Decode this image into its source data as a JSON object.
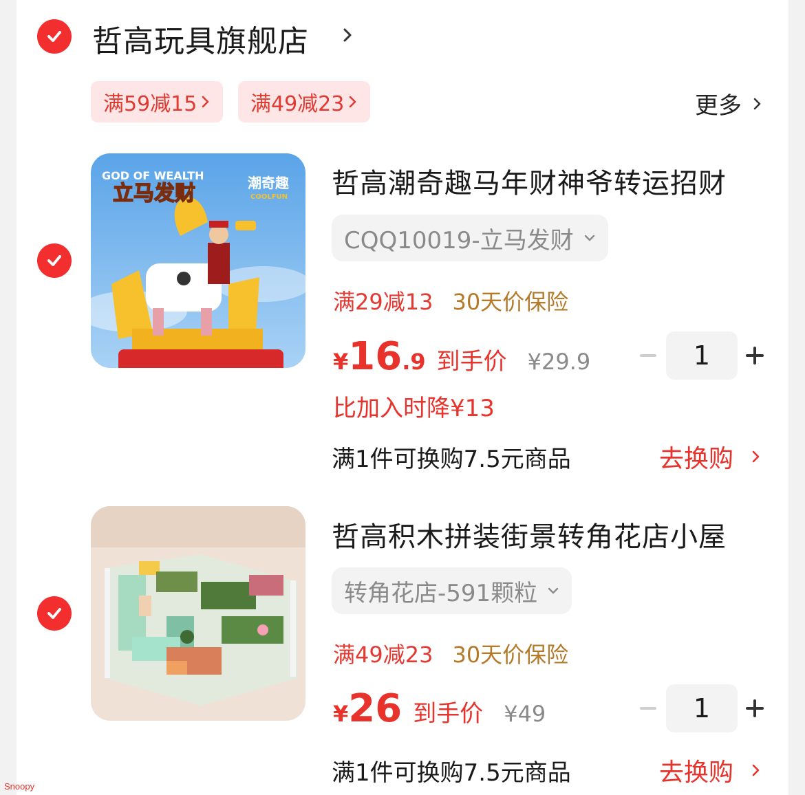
{
  "store": {
    "name": "哲高玩具旗舰店"
  },
  "coupons": [
    {
      "label": "满59减15"
    },
    {
      "label": "满49减23"
    }
  ],
  "more_label": "更多",
  "items": [
    {
      "title": "哲高潮奇趣马年财神爷转运招财",
      "image_text": {
        "top": "GOD OF WEALTH",
        "main": "立马发财",
        "brand_cn": "潮奇趣",
        "brand_en": "COOLFUN"
      },
      "sku": "CQQ10019-立马发财",
      "promo": "满29减13",
      "insurance": "30天价保险",
      "price_yen": "¥",
      "price_int": "16",
      "price_dec": ".9",
      "price_label": "到手价",
      "original_price": "¥29.9",
      "price_drop": "比加入时降¥13",
      "quantity": "1",
      "exchange": "满1件可换购7.5元商品",
      "exchange_link": "去换购"
    },
    {
      "title": "哲高积木拼装街景转角花店小屋",
      "sku": "转角花店-591颗粒",
      "promo": "满49减23",
      "insurance": "30天价保险",
      "price_yen": "¥",
      "price_int": "26",
      "price_label": "到手价",
      "original_price": "¥49",
      "quantity": "1",
      "exchange": "满1件可换购7.5元商品",
      "exchange_link": "去换购"
    }
  ],
  "watermark": "Snoopy",
  "colors": {
    "accent": "#e8322c",
    "check": "#f22e2e",
    "coupon_bg": "#fde6e5",
    "gold": "#b47a2a"
  }
}
